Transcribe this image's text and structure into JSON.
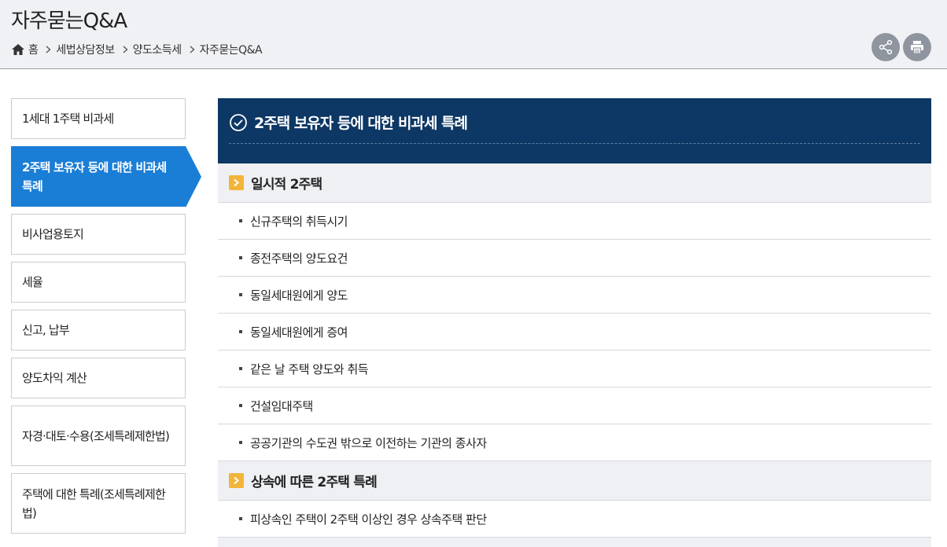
{
  "header": {
    "title": "자주묻는Q&A",
    "breadcrumb": [
      {
        "label": "홈"
      },
      {
        "label": "세법상담정보"
      },
      {
        "label": "양도소득세"
      },
      {
        "label": "자주묻는Q&A"
      }
    ],
    "actions": {
      "share_icon": "share-icon",
      "print_icon": "print-icon"
    }
  },
  "sidebar": {
    "items": [
      {
        "label": "1세대 1주택 비과세",
        "active": false
      },
      {
        "label": "2주택 보유자 등에 대한 비과세 특례",
        "active": true
      },
      {
        "label": "비사업용토지",
        "active": false
      },
      {
        "label": "세율",
        "active": false
      },
      {
        "label": "신고, 납부",
        "active": false
      },
      {
        "label": "양도차익 계산",
        "active": false
      },
      {
        "label": "자경·대토·수용(조세특례제한법)",
        "active": false
      },
      {
        "label": "주택에 대한 특례(조세특례제한법)",
        "active": false
      }
    ]
  },
  "content": {
    "title": "2주택 보유자 등에 대한 비과세 특례",
    "sections": [
      {
        "title": "일시적 2주택",
        "items": [
          "신규주택의 취득시기",
          "종전주택의 양도요건",
          "동일세대원에게 양도",
          "동일세대원에게 증여",
          "같은 날 주택 양도와 취득",
          "건설임대주택",
          "공공기관의 수도권 밖으로 이전하는 기관의 종사자"
        ]
      },
      {
        "title": "상속에 따른 2주택 특례",
        "items": [
          "피상속인 주택이 2주택 이상인 경우 상속주택 판단"
        ]
      }
    ]
  },
  "colors": {
    "header_bg": "#f0f1f4",
    "active_nav": "#1a7ed6",
    "content_head": "#0d3764",
    "section_icon": "#f2b53a"
  }
}
